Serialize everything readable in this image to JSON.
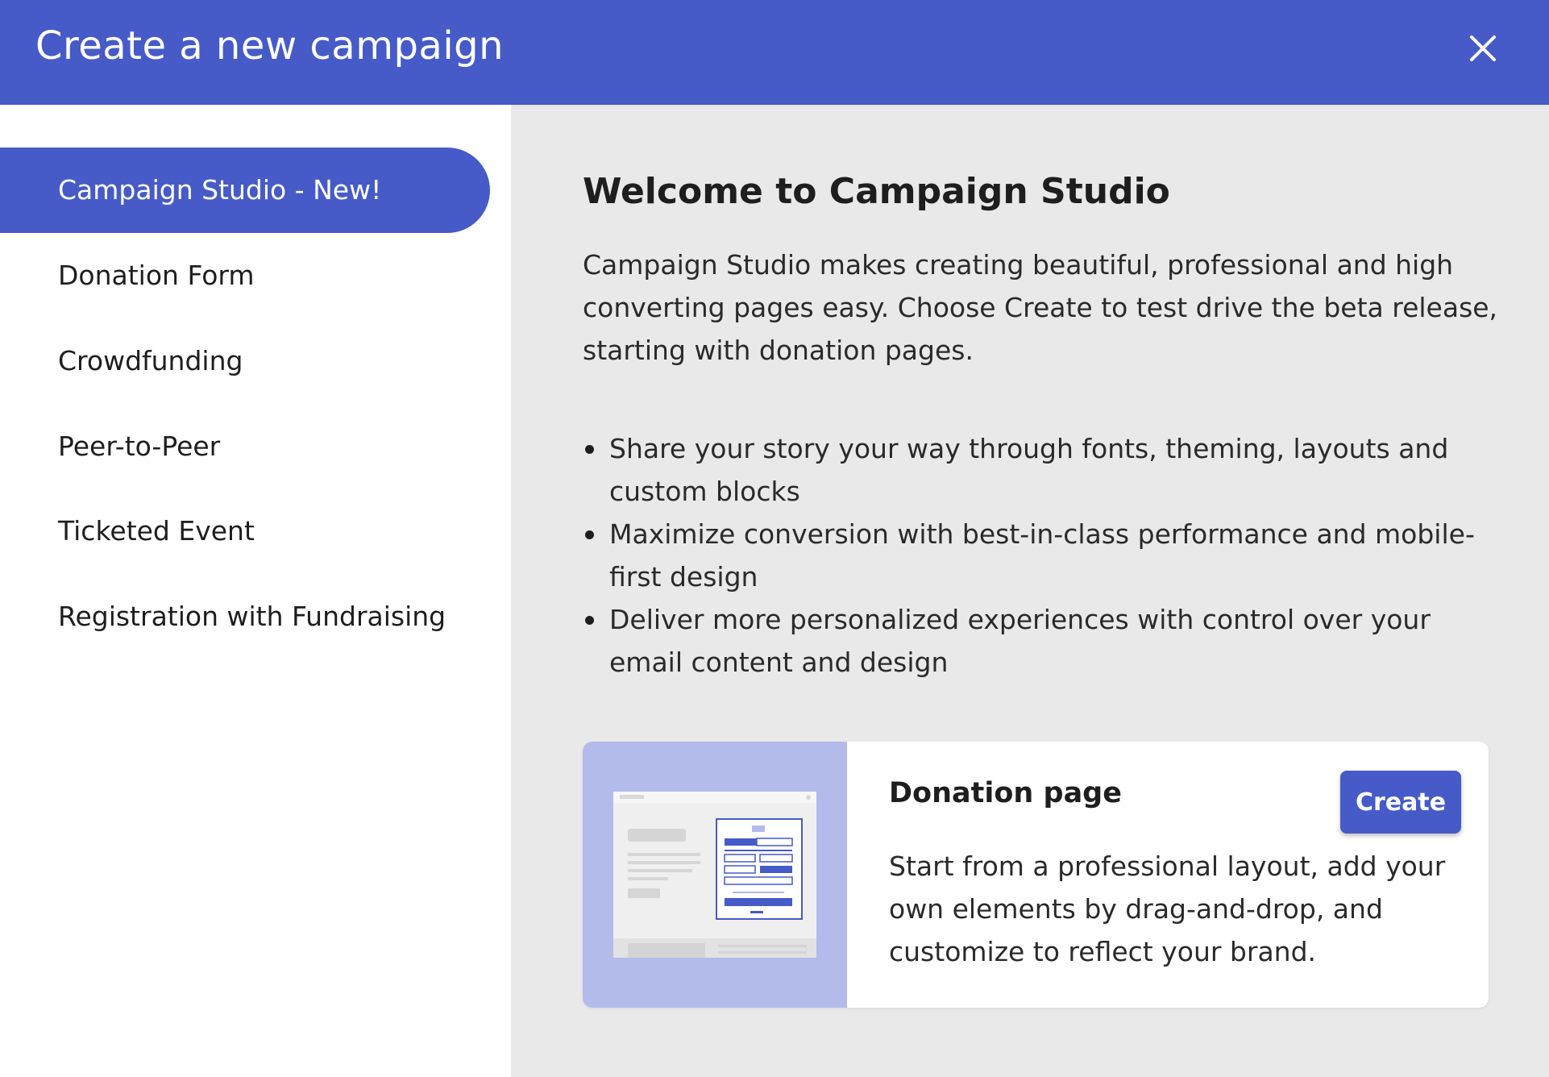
{
  "header": {
    "title": "Create a new campaign",
    "close_icon": "close-icon",
    "color": "#465bc8"
  },
  "sidebar": {
    "items": [
      {
        "label": "Campaign Studio - New!",
        "active": true
      },
      {
        "label": "Donation Form",
        "active": false
      },
      {
        "label": "Crowdfunding",
        "active": false
      },
      {
        "label": "Peer-to-Peer",
        "active": false
      },
      {
        "label": "Ticketed Event",
        "active": false
      },
      {
        "label": "Registration with Fundraising",
        "active": false
      }
    ]
  },
  "main": {
    "title": "Welcome to Campaign Studio",
    "intro": "Campaign Studio makes creating beautiful, professional and high converting pages easy. Choose Create to test drive the beta release, starting with donation pages.",
    "bullets": [
      "Share your story your way through fonts, theming, layouts and custom blocks",
      "Maximize conversion with best-in-class performance and mobile-first design",
      "Deliver more personalized experiences with control over your email content and design"
    ],
    "card": {
      "title": "Donation page",
      "button_label": "Create",
      "description": "Start from a professional layout, add your own elements by drag-and-drop, and customize to reflect your brand.",
      "thumbnail_icon": "donation-page-preview"
    }
  }
}
